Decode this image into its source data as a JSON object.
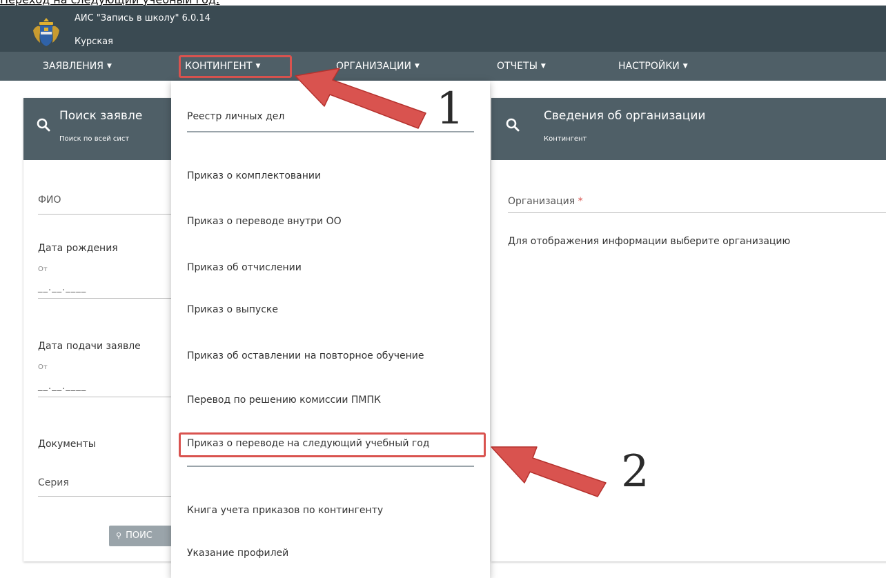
{
  "caption": "Переход на следующий учебный год:",
  "app": {
    "title": "АИС \"Запись в школу\" 6.0.14",
    "region": "Курская",
    "logo_icon": "coat-of-arms-icon"
  },
  "nav": [
    {
      "label": "ЗАЯВЛЕНИЯ"
    },
    {
      "label": "КОНТИНГЕНТ"
    },
    {
      "label": "ОРГАНИЗАЦИИ"
    },
    {
      "label": "ОТЧЕТЫ"
    },
    {
      "label": "НАСТРОЙКИ"
    }
  ],
  "dropdown": {
    "items": [
      "Реестр личных дел",
      "Приказ о комплектовании",
      "Приказ о переводе внутри ОО",
      "Приказ об отчислении",
      "Приказ о выпуске",
      "Приказ об оставлении на повторное обучение",
      "Перевод по решению комиссии ПМПК",
      "Приказ о переводе на следующий учебный год",
      "Книга учета приказов по контингенту",
      "Указание профилей"
    ]
  },
  "left_panel": {
    "title": "Поиск заявле",
    "subtitle": "Поиск по всей сист",
    "fio_label": "ФИО",
    "birth_label": "Дата рождения",
    "birth_from": "От",
    "birth_mask": "__.__.____",
    "submit_label": "Дата подачи заявле",
    "submit_from": "От",
    "submit_mask": "__.__.____",
    "docs_label": "Документы",
    "series_label": "Серия",
    "search_button": "ПОИС"
  },
  "right_panel": {
    "title": "Сведения об организации",
    "subtitle": "Контингент",
    "org_label": "Организация",
    "org_required": "*",
    "info": "Для отображения информации выберите организацию"
  },
  "annotations": {
    "step1": "1",
    "step2": "2",
    "arrow_color": "#d9534f"
  }
}
